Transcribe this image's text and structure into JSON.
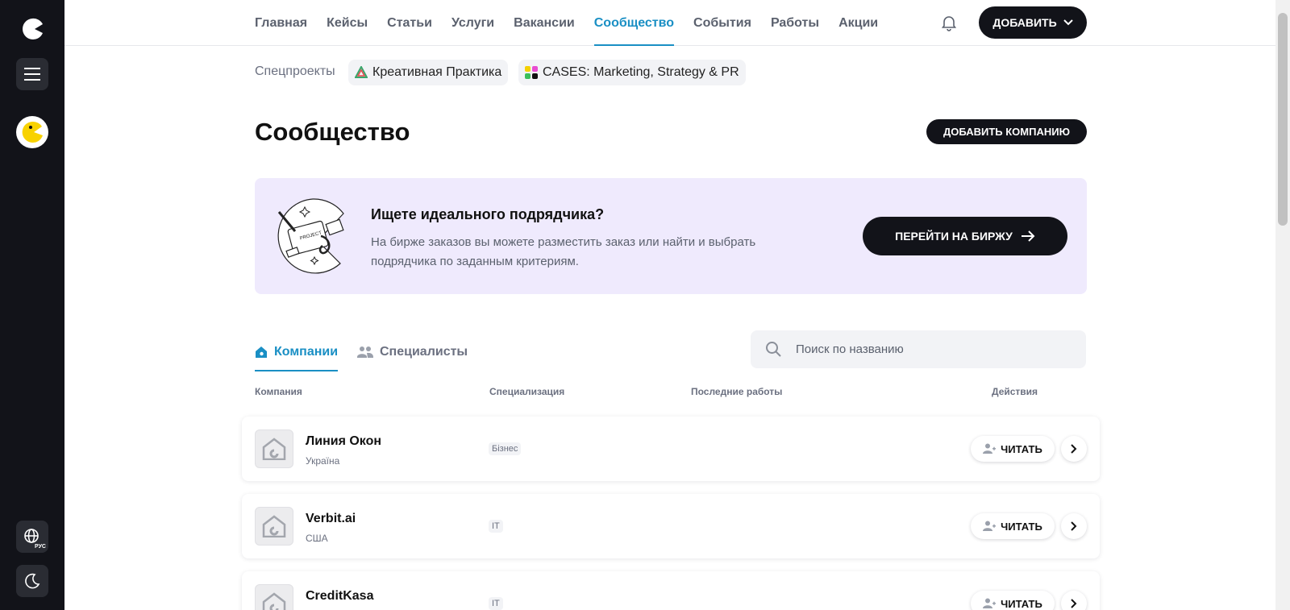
{
  "nav": {
    "items": [
      {
        "label": "Главная",
        "active": false
      },
      {
        "label": "Кейсы",
        "active": false
      },
      {
        "label": "Статьи",
        "active": false
      },
      {
        "label": "Услуги",
        "active": false
      },
      {
        "label": "Вакансии",
        "active": false
      },
      {
        "label": "Сообщество",
        "active": true
      },
      {
        "label": "События",
        "active": false
      },
      {
        "label": "Работы",
        "active": false
      },
      {
        "label": "Акции",
        "active": false
      }
    ],
    "add_label": "ДОБАВИТЬ"
  },
  "sidebar": {
    "lang_label": "РУС"
  },
  "special_projects": {
    "label": "Спецпроекты",
    "chips": [
      "Креативная Практика",
      "CASES: Marketing, Strategy & PR"
    ]
  },
  "page": {
    "title": "Сообщество",
    "add_company_label": "ДОБАВИТЬ КОМПАНИЮ"
  },
  "banner": {
    "title": "Ищете идеального подрядчика?",
    "text": "На бирже заказов вы можете разместить заказ или найти и выбрать подрядчика по заданным критериям.",
    "button_label": "ПЕРЕЙТИ НА БИРЖУ",
    "illustration_text": "PROJECT"
  },
  "tabs": [
    {
      "label": "Компании",
      "active": true
    },
    {
      "label": "Специалисты",
      "active": false
    }
  ],
  "search": {
    "placeholder": "Поиск по названию",
    "value": ""
  },
  "table": {
    "headers": [
      "Компания",
      "Специализация",
      "Последние работы",
      "Действия"
    ],
    "read_label": "ЧИТАТЬ",
    "rows": [
      {
        "name": "Линия Окон",
        "country": "Україна",
        "tag": "Бізнес"
      },
      {
        "name": "Verbit.ai",
        "country": "США",
        "tag": "IT"
      },
      {
        "name": "CreditKasa",
        "country": "",
        "tag": "IT"
      }
    ]
  },
  "colors": {
    "accent": "#1a8fc4",
    "dark": "#121319",
    "banner_bg": "#efeafd"
  }
}
